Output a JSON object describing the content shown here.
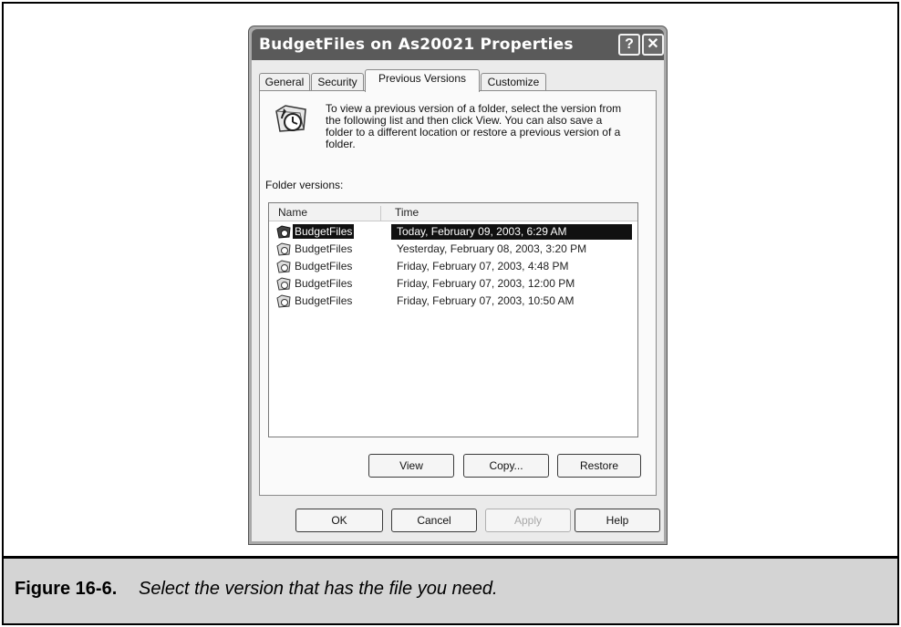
{
  "dialog": {
    "title": "BudgetFiles on As20021 Properties",
    "help_button": "?",
    "close_button": "✕"
  },
  "tabs": [
    {
      "label": "General",
      "active": false
    },
    {
      "label": "Security",
      "active": false
    },
    {
      "label": "Previous Versions",
      "active": true
    },
    {
      "label": "Customize",
      "active": false
    }
  ],
  "panel": {
    "info_text": "To view a previous version of a folder, select the version from the following list and then click View.  You can also save a folder to a different location or restore a previous version of a folder.",
    "versions_label": "Folder versions:",
    "columns": {
      "name": "Name",
      "time": "Time"
    },
    "rows": [
      {
        "name": "BudgetFiles",
        "time": "Today, February 09, 2003, 6:29 AM",
        "selected": true
      },
      {
        "name": "BudgetFiles",
        "time": "Yesterday, February 08, 2003, 3:20 PM",
        "selected": false
      },
      {
        "name": "BudgetFiles",
        "time": "Friday, February 07, 2003, 4:48 PM",
        "selected": false
      },
      {
        "name": "BudgetFiles",
        "time": "Friday, February 07, 2003, 12:00 PM",
        "selected": false
      },
      {
        "name": "BudgetFiles",
        "time": "Friday, February 07, 2003, 10:50 AM",
        "selected": false
      }
    ],
    "buttons": {
      "view": "View",
      "copy": "Copy...",
      "restore": "Restore"
    }
  },
  "footer": {
    "ok": "OK",
    "cancel": "Cancel",
    "apply": "Apply",
    "help": "Help"
  },
  "caption": {
    "number": "Figure 16-6.",
    "text": "Select the version that has the file you need."
  },
  "icons": {
    "info": "folder-clock-icon",
    "row": "folder-version-icon"
  }
}
